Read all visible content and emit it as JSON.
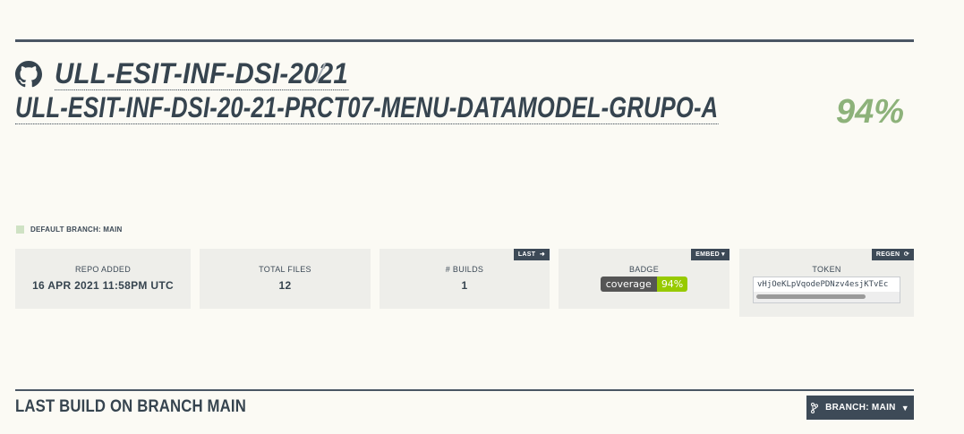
{
  "header": {
    "owner": "ULL-ESIT-INF-DSI-2021",
    "separator": "/",
    "repo": "ULL-ESIT-INF-DSI-20-21-PRCT07-MENU-DATAMODEL-GRUPO-A",
    "coverage": "94%",
    "icon": "github-icon"
  },
  "default_branch": {
    "label": "DEFAULT BRANCH: MAIN"
  },
  "cards": {
    "repo_added": {
      "label": "REPO ADDED",
      "value": "16 APR 2021 11:58PM UTC"
    },
    "total_files": {
      "label": "TOTAL FILES",
      "value": "12"
    },
    "builds": {
      "label": "# BUILDS",
      "value": "1",
      "button": "LAST"
    },
    "badge": {
      "label": "BADGE",
      "button": "EMBED ▾",
      "badge_left": "coverage",
      "badge_right": "94%"
    },
    "token": {
      "label": "TOKEN",
      "button": "REGEN",
      "value": "vHjOeKLpVqodePDNzv4esjKTvEc"
    }
  },
  "last_build": {
    "title": "LAST BUILD ON BRANCH MAIN",
    "branch_button": "BRANCH: MAIN"
  },
  "colors": {
    "accent": "#3d4a57",
    "coverage_green": "#8db27a",
    "badge_green": "#97ca00"
  }
}
